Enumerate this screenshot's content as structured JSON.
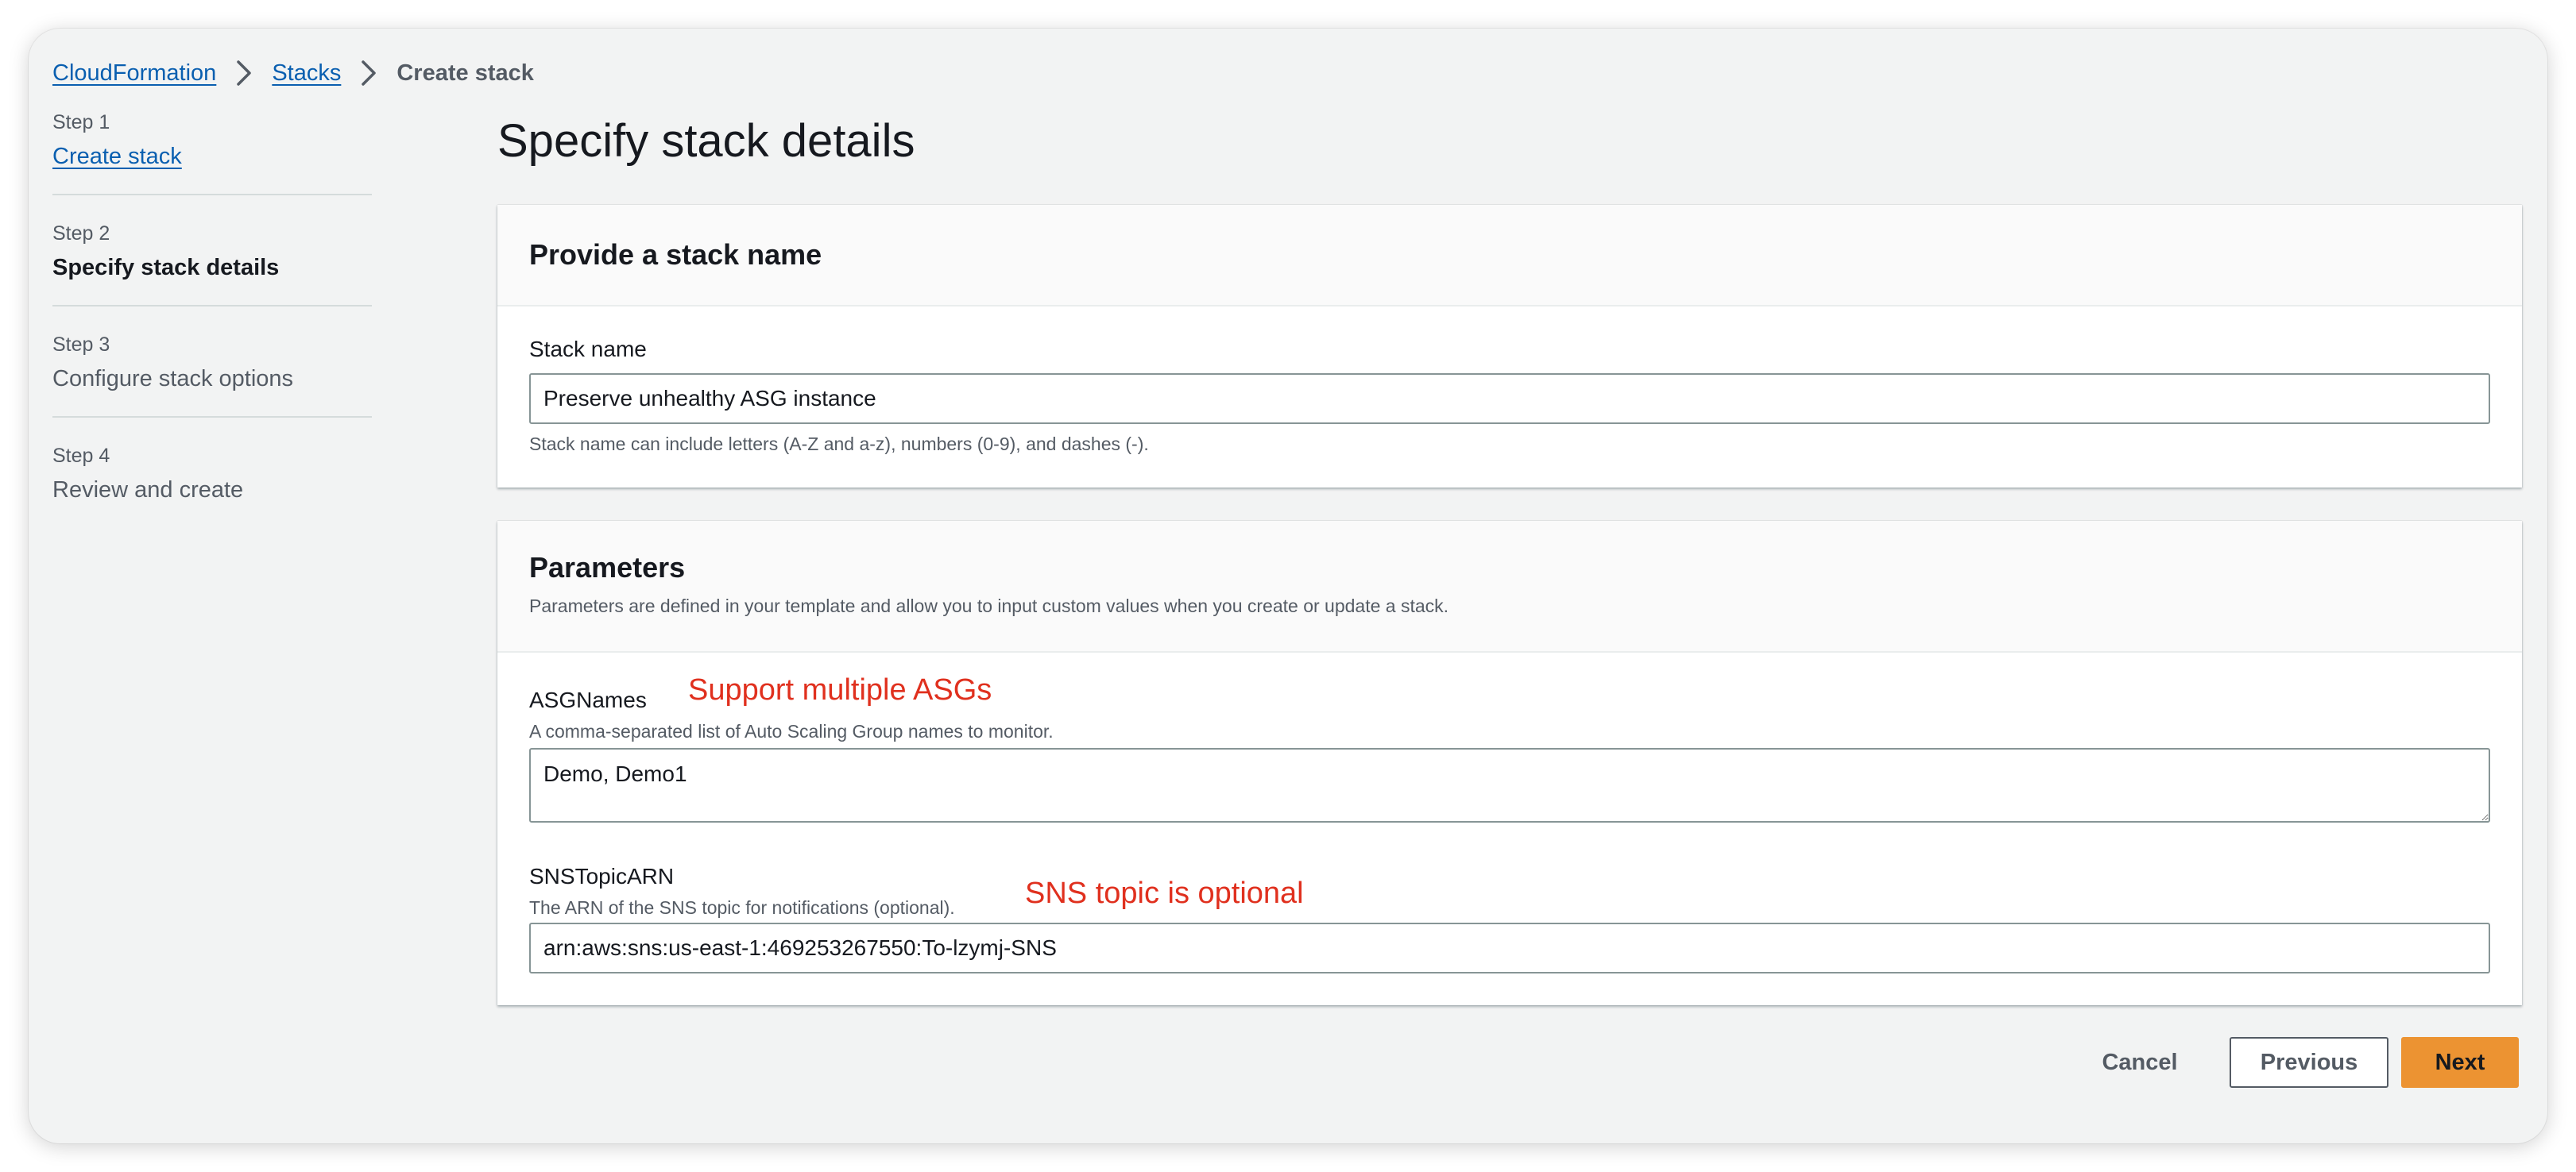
{
  "breadcrumb": {
    "items": [
      "CloudFormation",
      "Stacks"
    ],
    "current": "Create stack"
  },
  "steps": [
    {
      "num": "Step 1",
      "label": "Create stack"
    },
    {
      "num": "Step 2",
      "label": "Specify stack details"
    },
    {
      "num": "Step 3",
      "label": "Configure stack options"
    },
    {
      "num": "Step 4",
      "label": "Review and create"
    }
  ],
  "page_title": "Specify stack details",
  "stack_name_section": {
    "title": "Provide a stack name",
    "field_label": "Stack name",
    "value": "Preserve unhealthy ASG instance",
    "hint": "Stack name can include letters (A-Z and a-z), numbers (0-9), and dashes (-)."
  },
  "parameters_section": {
    "title": "Parameters",
    "description": "Parameters are defined in your template and allow you to input custom values when you create or update a stack.",
    "asg": {
      "label": "ASGNames",
      "description": "A comma-separated list of Auto Scaling Group names to monitor.",
      "value": "Demo, Demo1",
      "annotation": "Support multiple ASGs"
    },
    "sns": {
      "label": "SNSTopicARN",
      "description": "The ARN of the SNS topic for notifications (optional).",
      "value": "arn:aws:sns:us-east-1:469253267550:To-lzymj-SNS",
      "annotation": "SNS topic is optional"
    }
  },
  "footer": {
    "cancel": "Cancel",
    "previous": "Previous",
    "next": "Next"
  },
  "icons": {
    "breadcrumb_separator": "chevron-right-icon",
    "textarea_resize": "resize-handle-icon"
  },
  "colors": {
    "link": "#0a5fb0",
    "primary_button": "#ec9332",
    "annotation": "#e0301e"
  }
}
